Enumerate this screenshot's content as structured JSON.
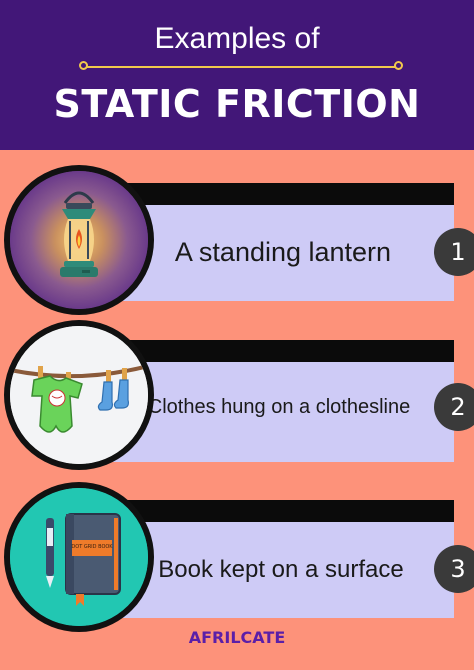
{
  "header": {
    "subtitle": "Examples of",
    "title": "STATIC FRICTION"
  },
  "items": [
    {
      "label": "A standing lantern",
      "number": "1",
      "icon": "lantern-icon"
    },
    {
      "label": "Clothes hung on a clothesline",
      "number": "2",
      "icon": "clothesline-icon"
    },
    {
      "label": "Book kept on a surface",
      "number": "3",
      "icon": "book-icon"
    }
  ],
  "book_cover_text": "DOT GRID BOOK",
  "footer": {
    "brand": "AFRILCATE"
  },
  "colors": {
    "header_bg": "#421778",
    "page_bg": "#fd927a",
    "card_bg": "#cecbf6",
    "accent_gold": "#f2c94c",
    "brand": "#5b1fa8"
  }
}
